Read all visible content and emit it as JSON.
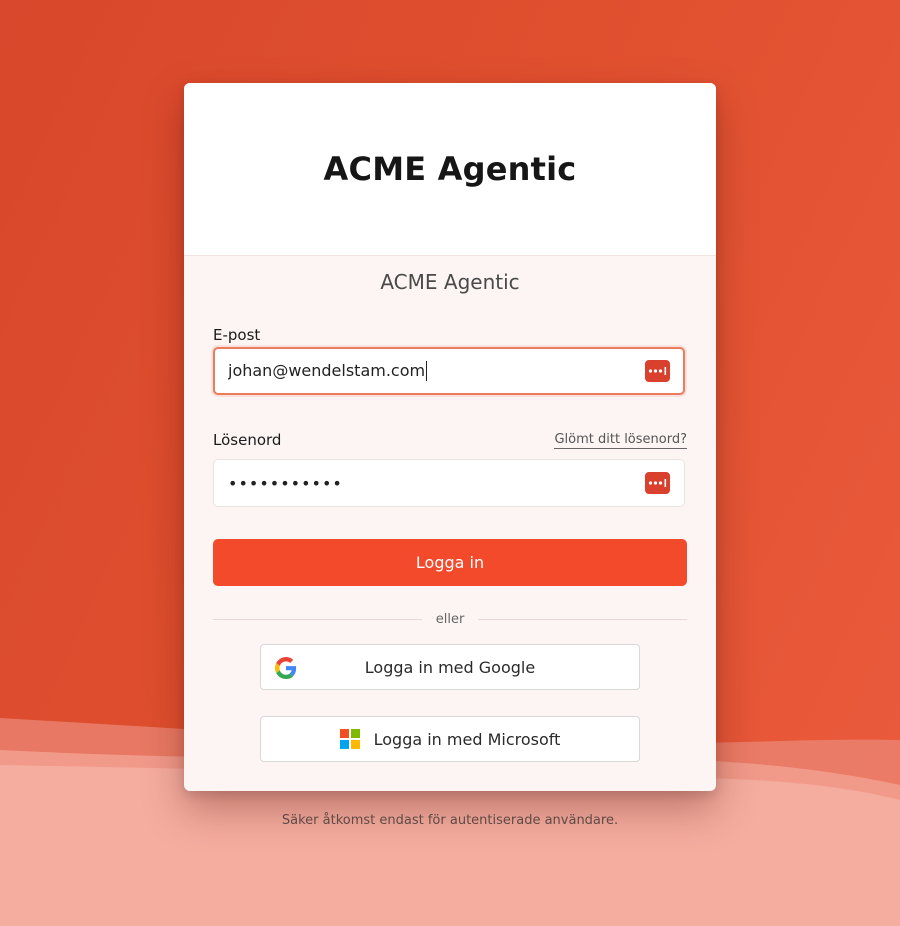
{
  "brand": {
    "header_title": "ACME Agentic",
    "subtitle": "ACME Agentic"
  },
  "form": {
    "email": {
      "label": "E-post",
      "value": "johan@wendelstam.com"
    },
    "password": {
      "label": "Lösenord",
      "masked_value": "•••••••••••",
      "forgot_link": "Glömt ditt lösenord?"
    },
    "submit_label": "Logga in",
    "divider_text": "eller"
  },
  "social": {
    "google_label": "Logga in med Google",
    "microsoft_label": "Logga in med Microsoft"
  },
  "footer": {
    "note": "Säker åtkomst endast för autentiserade användare."
  },
  "icons": {
    "password_manager": "password-manager-icon",
    "google": "google-logo-icon",
    "microsoft": "microsoft-logo-icon"
  },
  "colors": {
    "accent": "#f24a2b",
    "password_manager": "#d9402d",
    "focus_border": "#ec7a5f"
  }
}
